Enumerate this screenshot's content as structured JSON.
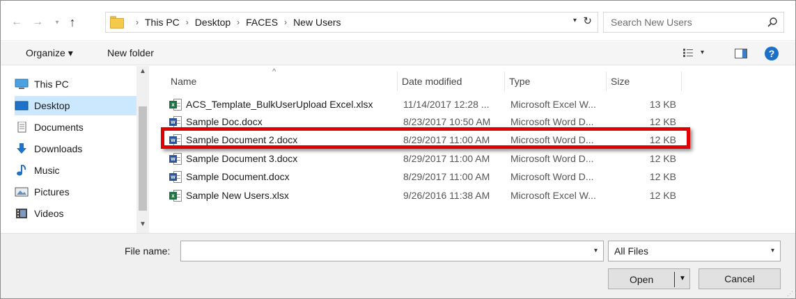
{
  "address": {
    "crumbs": [
      "This PC",
      "Desktop",
      "FACES",
      "New Users"
    ],
    "separator": "›"
  },
  "search": {
    "placeholder": "Search New Users"
  },
  "toolbar": {
    "organize_label": "Organize ▾",
    "new_folder_label": "New folder",
    "help_label": "?"
  },
  "nav": {
    "items": [
      {
        "label": "This PC",
        "icon": "computer-icon"
      },
      {
        "label": "Desktop",
        "icon": "desktop-icon",
        "selected": true
      },
      {
        "label": "Documents",
        "icon": "documents-icon"
      },
      {
        "label": "Downloads",
        "icon": "downloads-icon"
      },
      {
        "label": "Music",
        "icon": "music-icon"
      },
      {
        "label": "Pictures",
        "icon": "pictures-icon"
      },
      {
        "label": "Videos",
        "icon": "videos-icon"
      }
    ]
  },
  "columns": {
    "name": "Name",
    "date": "Date modified",
    "type": "Type",
    "size": "Size"
  },
  "files": [
    {
      "name": "ACS_Template_BulkUserUpload Excel.xlsx",
      "date": "11/14/2017 12:28 ...",
      "type": "Microsoft Excel W...",
      "size": "13 KB",
      "kind": "excel"
    },
    {
      "name": "Sample Doc.docx",
      "date": "8/23/2017 10:50 AM",
      "type": "Microsoft Word D...",
      "size": "12 KB",
      "kind": "word"
    },
    {
      "name": "Sample Document 2.docx",
      "date": "8/29/2017 11:00 AM",
      "type": "Microsoft Word D...",
      "size": "12 KB",
      "kind": "word"
    },
    {
      "name": "Sample Document 3.docx",
      "date": "8/29/2017 11:00 AM",
      "type": "Microsoft Word D...",
      "size": "12 KB",
      "kind": "word"
    },
    {
      "name": "Sample Document.docx",
      "date": "8/29/2017 11:00 AM",
      "type": "Microsoft Word D...",
      "size": "12 KB",
      "kind": "word"
    },
    {
      "name": "Sample New Users.xlsx",
      "date": "9/26/2016 11:38 AM",
      "type": "Microsoft Excel W...",
      "size": "12 KB",
      "kind": "excel"
    }
  ],
  "highlighted_file": "Sample Document 2.docx",
  "bottom": {
    "file_name_label": "File name:",
    "file_name_value": "",
    "filter_value": "All Files",
    "open_label": "Open",
    "cancel_label": "Cancel"
  },
  "colors": {
    "highlight_border": "#e00000",
    "selection_bg": "#cce8ff",
    "excel": "#1f7244",
    "word": "#2b579a"
  }
}
